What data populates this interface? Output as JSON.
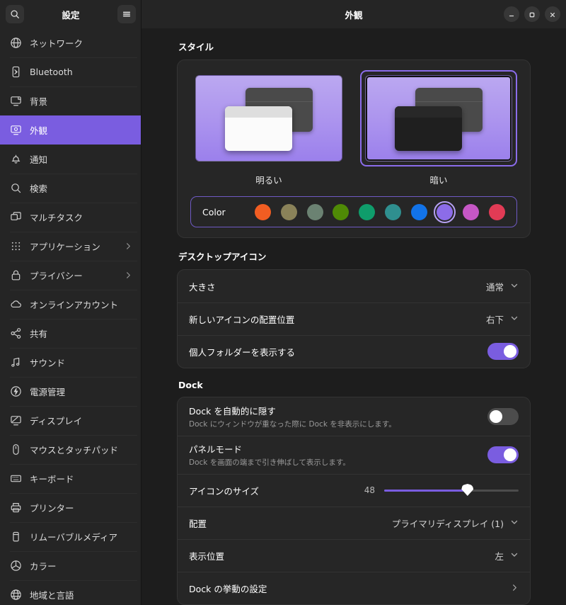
{
  "header": {
    "sidebar_title": "設定",
    "search_icon": "search-icon",
    "menu_icon": "hamburger-menu-icon",
    "page_title": "外観",
    "minimize_label": "–",
    "maximize_label": "□",
    "close_label": "✕"
  },
  "accent": "#7a5de0",
  "sidebar": {
    "items": [
      {
        "label": "ネットワーク",
        "icon": "network-globe-icon",
        "selected": false,
        "chevron": false
      },
      {
        "label": "Bluetooth",
        "icon": "bluetooth-icon",
        "selected": false,
        "chevron": false
      },
      {
        "label": "背景",
        "icon": "background-wallpaper-icon",
        "selected": false,
        "chevron": false
      },
      {
        "label": "外観",
        "icon": "appearance-monitor-icon",
        "selected": true,
        "chevron": false
      },
      {
        "label": "通知",
        "icon": "bell-notification-icon",
        "selected": false,
        "chevron": false
      },
      {
        "label": "検索",
        "icon": "search-icon",
        "selected": false,
        "chevron": false
      },
      {
        "label": "マルチタスク",
        "icon": "multitasking-windows-icon",
        "selected": false,
        "chevron": false
      },
      {
        "label": "アプリケーション",
        "icon": "apps-grid-icon",
        "selected": false,
        "chevron": true
      },
      {
        "label": "プライバシー",
        "icon": "lock-privacy-icon",
        "selected": false,
        "chevron": true
      },
      {
        "label": "オンラインアカウント",
        "icon": "cloud-account-icon",
        "selected": false,
        "chevron": false
      },
      {
        "label": "共有",
        "icon": "share-nodes-icon",
        "selected": false,
        "chevron": false
      },
      {
        "label": "サウンド",
        "icon": "sound-note-icon",
        "selected": false,
        "chevron": false
      },
      {
        "label": "電源管理",
        "icon": "power-icon",
        "selected": false,
        "chevron": false
      },
      {
        "label": "ディスプレイ",
        "icon": "display-monitor-icon",
        "selected": false,
        "chevron": false
      },
      {
        "label": "マウスとタッチパッド",
        "icon": "mouse-icon",
        "selected": false,
        "chevron": false
      },
      {
        "label": "キーボード",
        "icon": "keyboard-icon",
        "selected": false,
        "chevron": false
      },
      {
        "label": "プリンター",
        "icon": "printer-icon",
        "selected": false,
        "chevron": false
      },
      {
        "label": "リムーバブルメディア",
        "icon": "removable-media-icon",
        "selected": false,
        "chevron": false
      },
      {
        "label": "カラー",
        "icon": "color-wheel-icon",
        "selected": false,
        "chevron": false
      },
      {
        "label": "地域と言語",
        "icon": "globe-language-icon",
        "selected": false,
        "chevron": false
      }
    ]
  },
  "style_section": {
    "title": "スタイル",
    "options": [
      {
        "label": "明るい",
        "selected": false
      },
      {
        "label": "暗い",
        "selected": true
      }
    ],
    "color_label": "Color",
    "swatches": [
      {
        "name": "orange",
        "hex": "#f15d22",
        "selected": false
      },
      {
        "name": "olive",
        "hex": "#8a8259",
        "selected": false
      },
      {
        "name": "sage",
        "hex": "#6b8272",
        "selected": false
      },
      {
        "name": "green",
        "hex": "#4f8a06",
        "selected": false
      },
      {
        "name": "emerald",
        "hex": "#0f9d6b",
        "selected": false
      },
      {
        "name": "teal",
        "hex": "#2f8f8f",
        "selected": false
      },
      {
        "name": "blue",
        "hex": "#1273e8",
        "selected": false
      },
      {
        "name": "purple",
        "hex": "#8c6ce8",
        "selected": true
      },
      {
        "name": "magenta",
        "hex": "#c557c5",
        "selected": false
      },
      {
        "name": "red",
        "hex": "#e13b55",
        "selected": false
      }
    ]
  },
  "desktop_icons_section": {
    "title": "デスクトップアイコン",
    "rows": [
      {
        "title": "大きさ",
        "sub": "",
        "control": "dropdown",
        "value": "通常"
      },
      {
        "title": "新しいアイコンの配置位置",
        "sub": "",
        "control": "dropdown",
        "value": "右下"
      },
      {
        "title": "個人フォルダーを表示する",
        "sub": "",
        "control": "toggle",
        "value": "on"
      }
    ]
  },
  "dock_section": {
    "title": "Dock",
    "rows": [
      {
        "title": "Dock を自動的に隠す",
        "sub": "Dock にウィンドウが重なった際に Dock を非表示にします。",
        "control": "toggle",
        "value": "off"
      },
      {
        "title": "パネルモード",
        "sub": "Dock を画面の端まで引き伸ばして表示します。",
        "control": "toggle",
        "value": "on"
      },
      {
        "title": "アイコンのサイズ",
        "sub": "",
        "control": "slider",
        "value": "48"
      },
      {
        "title": "配置",
        "sub": "",
        "control": "dropdown",
        "value": "プライマリディスプレイ (1)"
      },
      {
        "title": "表示位置",
        "sub": "",
        "control": "dropdown",
        "value": "左"
      },
      {
        "title": "Dock の挙動の設定",
        "sub": "",
        "control": "navigate",
        "value": ""
      }
    ]
  }
}
